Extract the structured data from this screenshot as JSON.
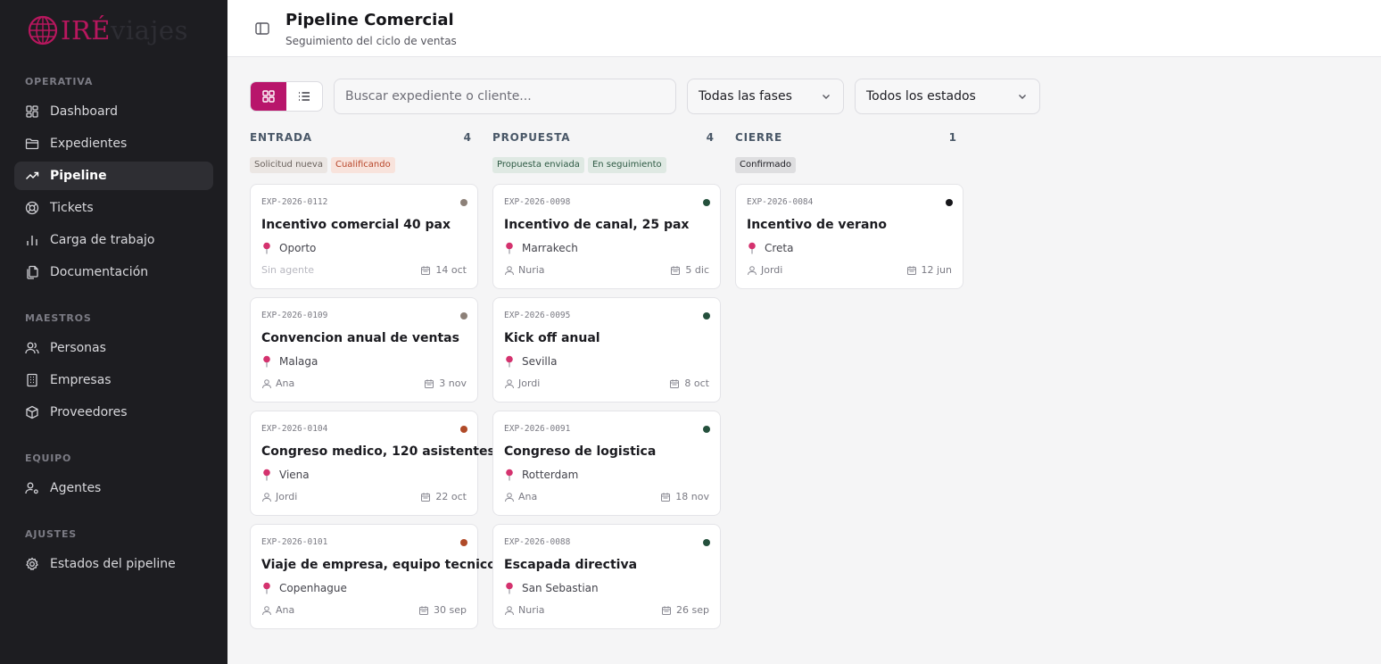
{
  "brand": {
    "part1": "IRÉ",
    "part2": "viajes"
  },
  "nav": {
    "sections": [
      {
        "label": "OPERATIVA"
      },
      {
        "label": "MAESTROS"
      },
      {
        "label": "EQUIPO"
      },
      {
        "label": "AJUSTES"
      }
    ],
    "items": [
      {
        "label": "Dashboard",
        "icon": "dashboard-icon"
      },
      {
        "label": "Expedientes",
        "icon": "folder-icon"
      },
      {
        "label": "Pipeline",
        "icon": "trend-icon",
        "active": true
      },
      {
        "label": "Tickets",
        "icon": "lifebuoy-icon"
      },
      {
        "label": "Carga de trabajo",
        "icon": "bar-chart-icon"
      },
      {
        "label": "Documentación",
        "icon": "documents-icon"
      },
      {
        "label": "Personas",
        "icon": "users-icon"
      },
      {
        "label": "Empresas",
        "icon": "building-icon"
      },
      {
        "label": "Proveedores",
        "icon": "package-icon"
      },
      {
        "label": "Agentes",
        "icon": "user-cog-icon"
      },
      {
        "label": "Estados del pipeline",
        "icon": "settings-icon"
      }
    ]
  },
  "header": {
    "title": "Pipeline Comercial",
    "subtitle": "Seguimiento del ciclo de ventas"
  },
  "toolbar": {
    "search_placeholder": "Buscar expediente o cliente...",
    "phase_filter": "Todas las fases",
    "status_filter": "Todos los estados",
    "active_view": "grid"
  },
  "columns": [
    {
      "title": "ENTRADA",
      "count": "4",
      "tags": [
        {
          "label": "Solicitud nueva",
          "bg": "#ebe6e3",
          "fg": "#6a625d"
        },
        {
          "label": "Cualificando",
          "bg": "#f8e3dc",
          "fg": "#b8462a"
        }
      ],
      "cards": [
        {
          "code": "EXP-2026-0112",
          "title": "Incentivo comercial 40 pax",
          "location": "Oporto",
          "agent": "Sin agente",
          "no_agent": true,
          "date": "14 oct",
          "dot": "#8c8078"
        },
        {
          "code": "EXP-2026-0109",
          "title": "Convencion anual de ventas",
          "location": "Malaga",
          "agent": "Ana",
          "date": "3 nov",
          "dot": "#8c8078"
        },
        {
          "code": "EXP-2026-0104",
          "title": "Congreso medico, 120 asistentes",
          "location": "Viena",
          "agent": "Jordi",
          "date": "22 oct",
          "dot": "#b04a28"
        },
        {
          "code": "EXP-2026-0101",
          "title": "Viaje de empresa, equipo tecnico",
          "location": "Copenhague",
          "agent": "Ana",
          "date": "30 sep",
          "dot": "#b04a28"
        }
      ]
    },
    {
      "title": "PROPUESTA",
      "count": "4",
      "tags": [
        {
          "label": "Propuesta enviada",
          "bg": "#dfe9e3",
          "fg": "#2e5a44"
        },
        {
          "label": "En seguimiento",
          "bg": "#dfe9e3",
          "fg": "#2e5a44"
        }
      ],
      "cards": [
        {
          "code": "EXP-2026-0098",
          "title": "Incentivo de canal, 25 pax",
          "location": "Marrakech",
          "agent": "Nuria",
          "date": "5 dic",
          "dot": "#24503c"
        },
        {
          "code": "EXP-2026-0095",
          "title": "Kick off anual",
          "location": "Sevilla",
          "agent": "Jordi",
          "date": "8 oct",
          "dot": "#24503c"
        },
        {
          "code": "EXP-2026-0091",
          "title": "Congreso de logistica",
          "location": "Rotterdam",
          "agent": "Ana",
          "date": "18 nov",
          "dot": "#24503c"
        },
        {
          "code": "EXP-2026-0088",
          "title": "Escapada directiva",
          "location": "San Sebastian",
          "agent": "Nuria",
          "date": "26 sep",
          "dot": "#24503c"
        }
      ]
    },
    {
      "title": "CIERRE",
      "count": "1",
      "tags": [
        {
          "label": "Confirmado",
          "bg": "#dedee0",
          "fg": "#1c1c22"
        }
      ],
      "cards": [
        {
          "code": "EXP-2026-0084",
          "title": "Incentivo de verano",
          "location": "Creta",
          "agent": "Jordi",
          "date": "12 jun",
          "dot": "#16161a"
        }
      ]
    }
  ],
  "colors": {
    "accent": "#b8156b",
    "sidebar_bg": "#1d1d21",
    "page_bg": "#f5f5f6"
  }
}
